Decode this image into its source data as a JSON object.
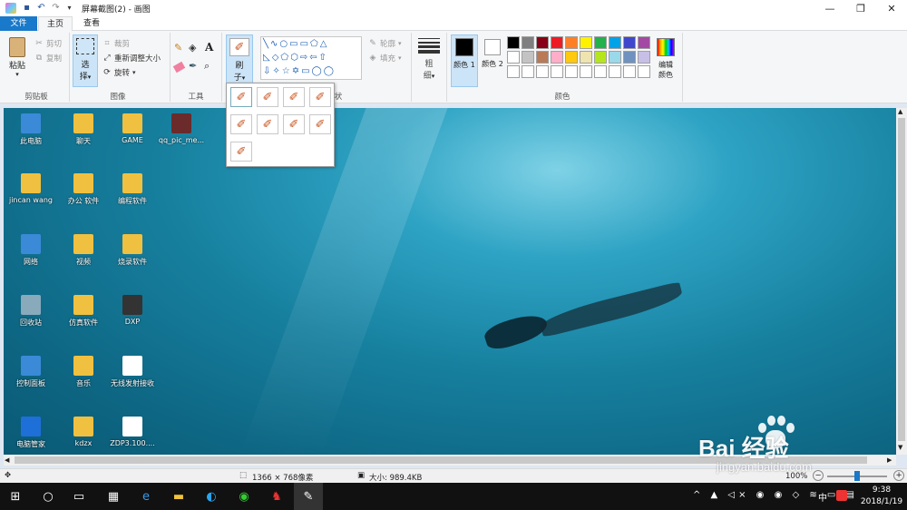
{
  "window": {
    "title": "屏幕截图(2) - 画图",
    "quick_access": [
      "save-icon",
      "undo-icon",
      "redo-icon",
      "customize-icon"
    ],
    "controls": [
      "—",
      "❐",
      "✕"
    ]
  },
  "tabs": {
    "file": "文件",
    "home": "主页",
    "view": "查看"
  },
  "clipboard": {
    "paste": "粘贴",
    "cut": "剪切",
    "copy": "复制",
    "group": "剪贴板"
  },
  "image": {
    "select": "选",
    "select2": "择",
    "crop": "裁剪",
    "resize": "重新调整大小",
    "rotate": "旋转",
    "group": "图像"
  },
  "tools": {
    "group": "工具"
  },
  "brushes": {
    "label1": "刷",
    "label2": "子"
  },
  "shapes": {
    "outline": "轮廓",
    "fill": "填充",
    "group_tail": "状"
  },
  "size": {
    "label1": "粗",
    "label2": "细"
  },
  "colors": {
    "color1": "颜色 1",
    "color2": "颜色 2",
    "edit": "编辑颜色",
    "edit1": "编辑",
    "edit2": "颜色",
    "group": "颜色",
    "color1_value": "#000000",
    "color2_value": "#ffffff",
    "palette_row1": [
      "#000000",
      "#7f7f7f",
      "#880015",
      "#ed1c24",
      "#ff7f27",
      "#fff200",
      "#22b14c",
      "#00a2e8",
      "#3f48cc",
      "#a349a4"
    ],
    "palette_row2": [
      "#ffffff",
      "#c3c3c3",
      "#b97a57",
      "#ffaec9",
      "#ffc90e",
      "#efe4b0",
      "#b5e61d",
      "#99d9ea",
      "#7092be",
      "#c8bfe7"
    ]
  },
  "desktop": [
    {
      "label": "此电脑"
    },
    {
      "label": "聊天"
    },
    {
      "label": "GAME"
    },
    {
      "label": "qq_pic_me..."
    },
    {
      "label": "jincan wang"
    },
    {
      "label": "办公 软件"
    },
    {
      "label": "编程软件"
    },
    {
      "label": "网络"
    },
    {
      "label": "视频"
    },
    {
      "label": "烧录软件"
    },
    {
      "label": "回收站"
    },
    {
      "label": "仿真软件"
    },
    {
      "label": "DXP"
    },
    {
      "label": "控制面板"
    },
    {
      "label": "音乐"
    },
    {
      "label": "无线发射接收"
    },
    {
      "label": "电脑管家"
    },
    {
      "label": "kdzx"
    },
    {
      "label": "ZDP3.100...."
    }
  ],
  "status": {
    "dimensions": "1366 × 768像素",
    "size": "大小: 989.4KB",
    "zoom": "100%",
    "zoom_fraction": 0.5
  },
  "taskbar": {
    "time": "9:38",
    "date": "2018/1/19",
    "ime": "中"
  },
  "watermark": {
    "brand": "Bai 经验",
    "url": "jingyan.baidu.com"
  }
}
